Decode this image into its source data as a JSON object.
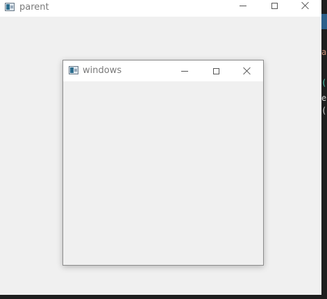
{
  "parent": {
    "title": "parent",
    "icon": "app-window-icon"
  },
  "child": {
    "title": "windows",
    "icon": "app-window-icon"
  },
  "editor": {
    "chars": [
      "a",
      "(",
      "e",
      "("
    ]
  },
  "colors": {
    "window_bg": "#f0f0f0",
    "titlebar_bg": "#ffffff",
    "editor_bg": "#1e1e1e",
    "editor_accent": "#2d5f8a"
  }
}
